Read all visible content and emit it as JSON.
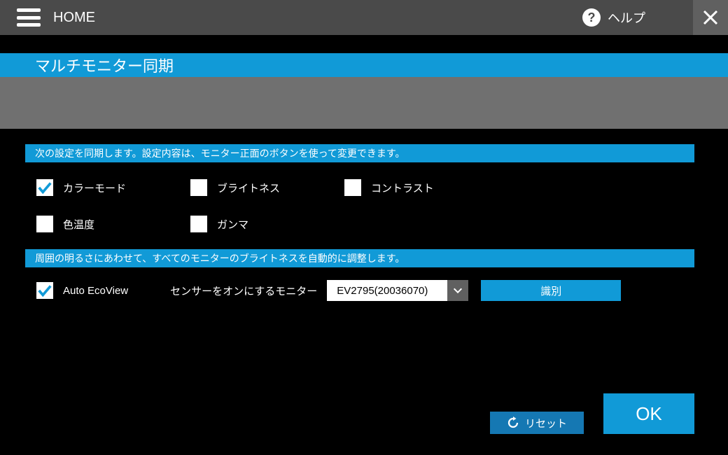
{
  "topbar": {
    "home_label": "HOME",
    "help_label": "ヘルプ"
  },
  "title": "マルチモニター同期",
  "section1": {
    "header": "次の設定を同期します。設定内容は、モニター正面のボタンを使って変更できます。",
    "opts": {
      "color_mode": {
        "label": "カラーモード",
        "checked": true
      },
      "brightness": {
        "label": "ブライトネス",
        "checked": false
      },
      "contrast": {
        "label": "コントラスト",
        "checked": false
      },
      "color_temp": {
        "label": "色温度",
        "checked": false
      },
      "gamma": {
        "label": "ガンマ",
        "checked": false
      }
    }
  },
  "section2": {
    "header": "周囲の明るさにあわせて、すべてのモニターのブライトネスを自動的に調整します。",
    "auto_ecoview": {
      "label": "Auto EcoView",
      "checked": true
    },
    "sensor_label": "センサーをオンにするモニター",
    "sensor_dropdown": {
      "selected": "EV2795(20036070)"
    },
    "identify_btn": "識別"
  },
  "footer": {
    "reset": "リセット",
    "ok": "OK"
  }
}
